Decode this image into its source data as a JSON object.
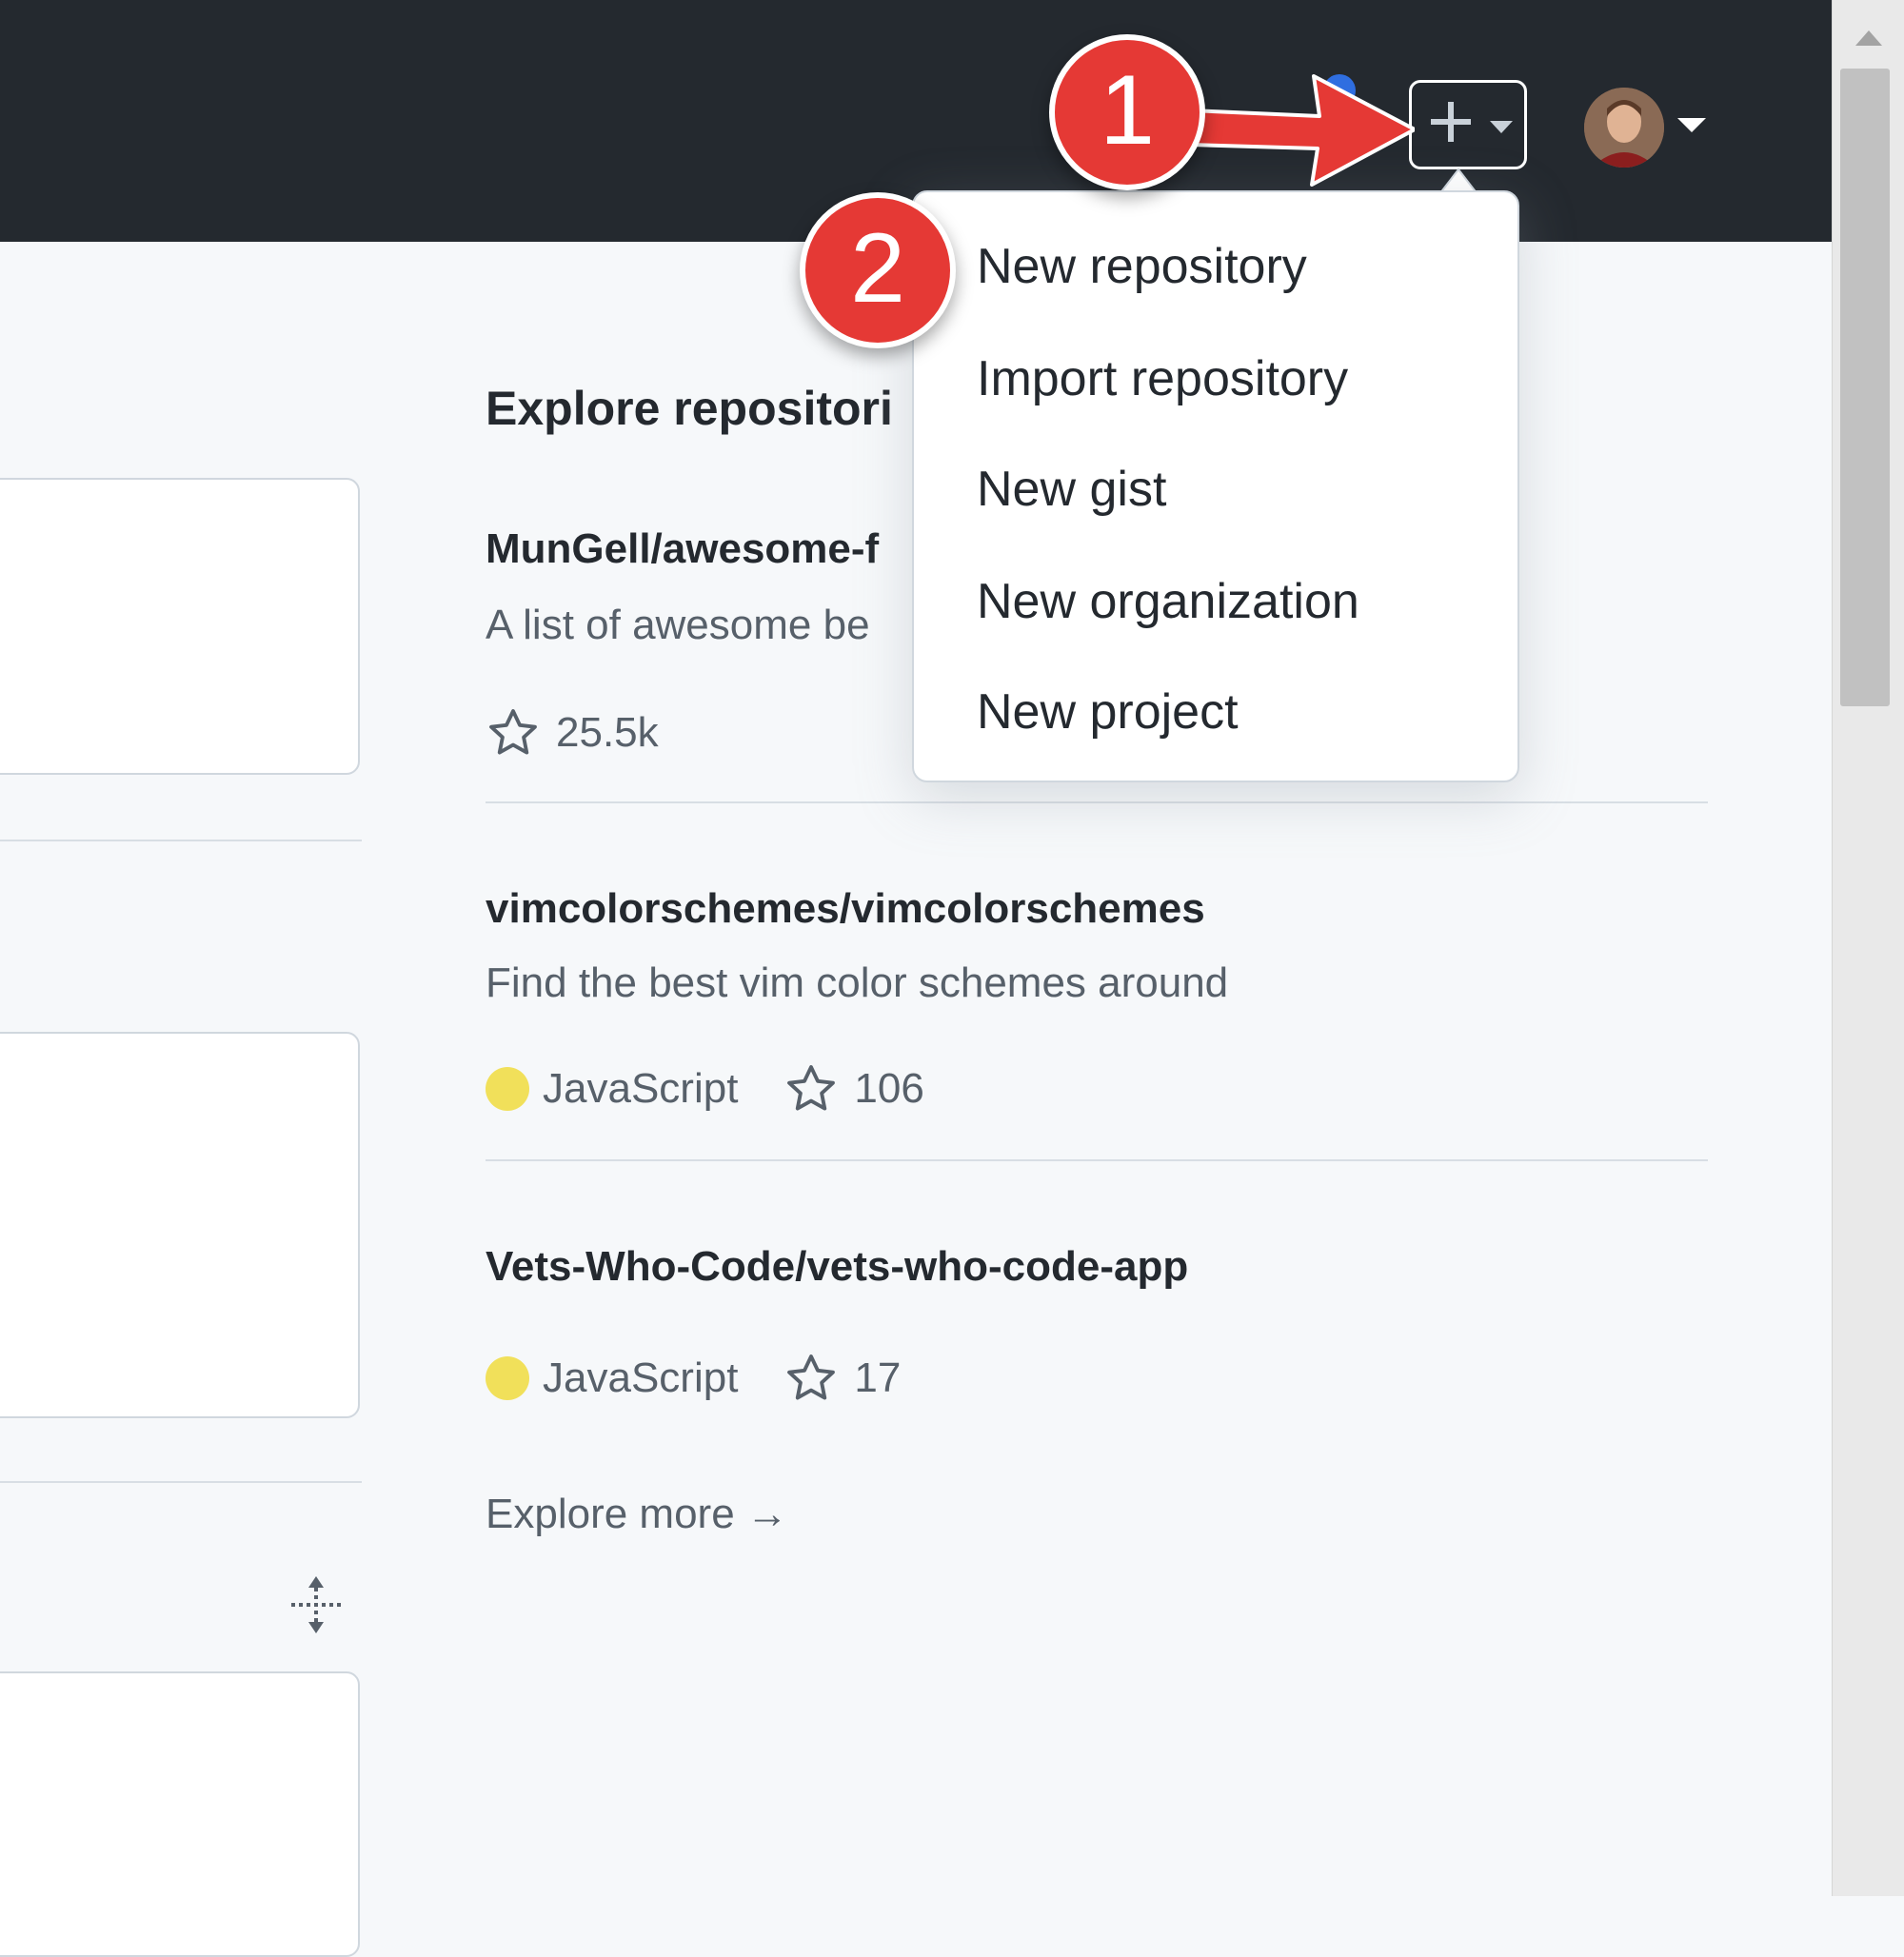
{
  "header": {
    "create_icon": "plus-icon",
    "create_caret_icon": "caret-down-icon",
    "avatar_caret_icon": "caret-down-icon"
  },
  "dropdown": {
    "items": [
      "New repository",
      "Import repository",
      "New gist",
      "New organization",
      "New project"
    ]
  },
  "explore": {
    "title": "Explore repositori",
    "repos": [
      {
        "name": "MunGell/awesome-f",
        "description": "A list of awesome be",
        "language": "",
        "stars": "25.5k"
      },
      {
        "name": "vimcolorschemes/vimcolorschemes",
        "description": "Find the best vim color schemes around",
        "language": "JavaScript",
        "stars": "106"
      },
      {
        "name": "Vets-Who-Code/vets-who-code-app",
        "description": "",
        "language": "JavaScript",
        "stars": "17"
      }
    ],
    "more": "Explore more →"
  },
  "annotations": {
    "step1": "1",
    "step2": "2"
  },
  "colors": {
    "header_bg": "#24292f",
    "page_bg": "#f6f8fa",
    "badge_red": "#e53935",
    "javascript": "#f1e05a"
  }
}
